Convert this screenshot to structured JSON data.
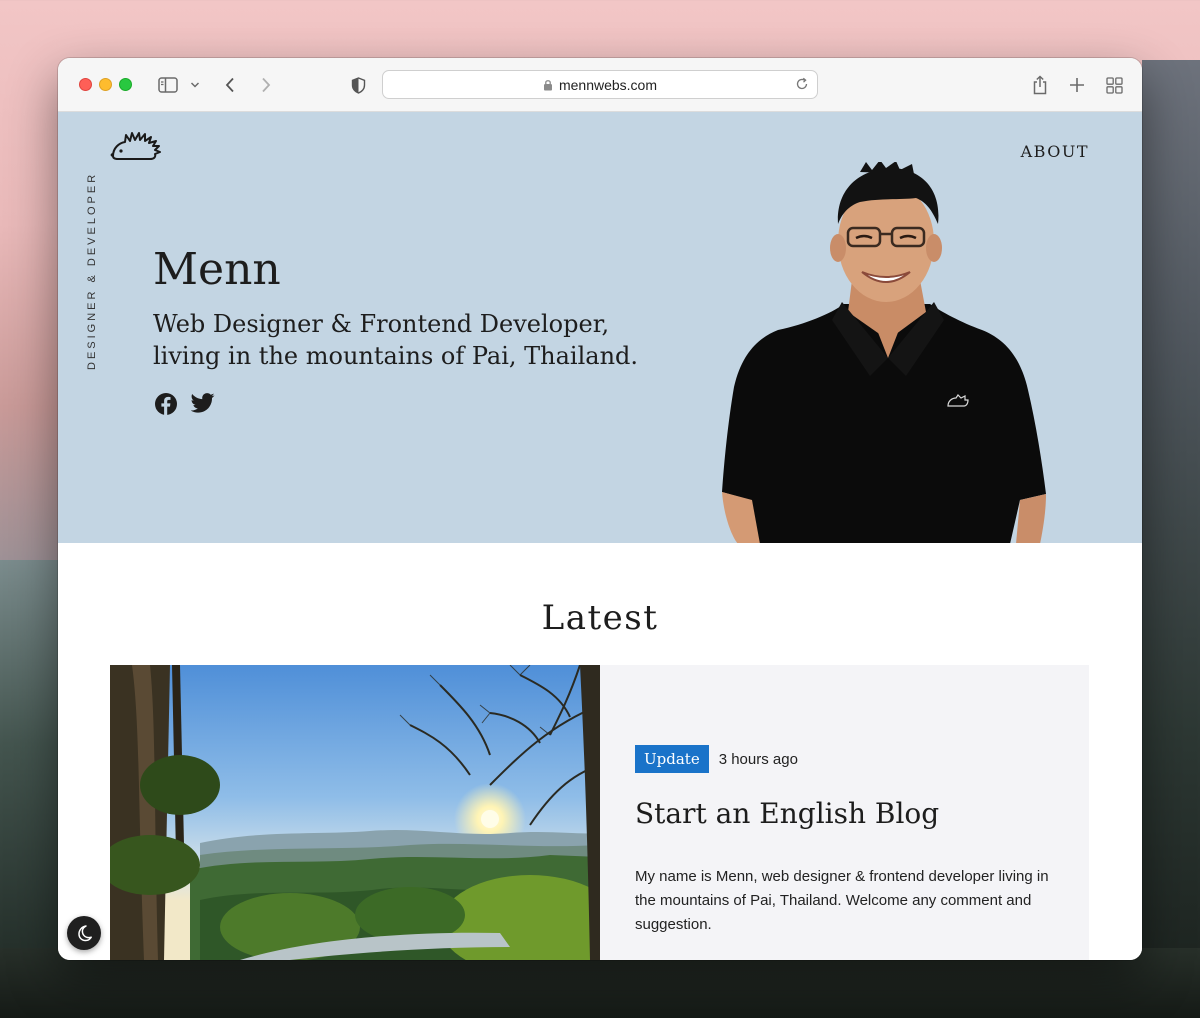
{
  "browser": {
    "url": "mennwebs.com"
  },
  "site": {
    "vertical_label": "DESIGNER & DEVELOPER",
    "nav": {
      "about": "ABOUT"
    },
    "hero": {
      "name": "Menn",
      "tagline": "Web Designer & Frontend Developer, living in the mountains of Pai, Thailand."
    },
    "social": [
      "facebook-icon",
      "twitter-icon"
    ]
  },
  "latest": {
    "heading": "Latest",
    "posts": [
      {
        "category": "Update",
        "time": "3 hours ago",
        "title": "Start an English Blog",
        "excerpt": "My name is Menn, web designer & frontend developer living in the mountains of Pai, Thailand. Welcome any comment and suggestion."
      }
    ]
  },
  "colors": {
    "hero_bg": "#c3d5e3",
    "badge_bg": "#1a73c9",
    "post_card_bg": "#f4f4f7",
    "traffic_red": "#fe5f57",
    "traffic_yellow": "#febc2e",
    "traffic_green": "#28c840"
  }
}
